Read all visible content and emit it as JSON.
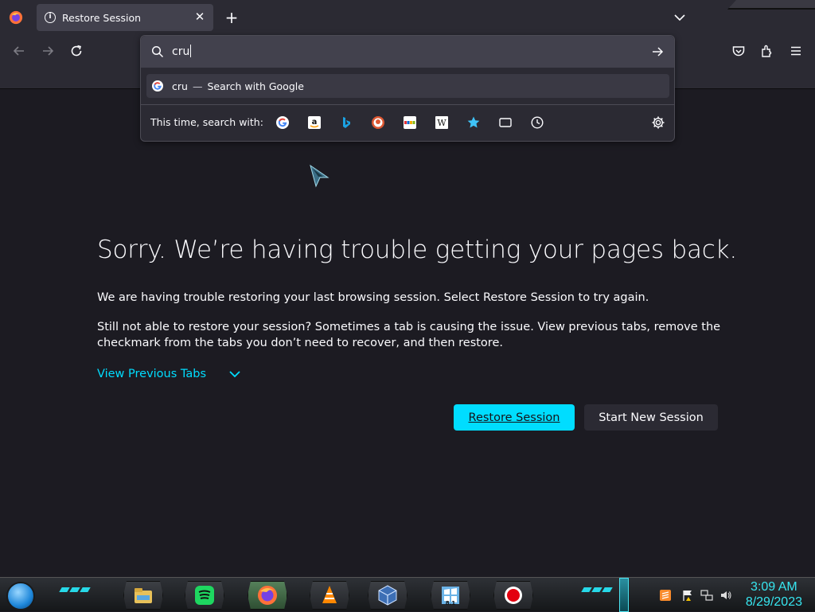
{
  "browser": {
    "tab": {
      "title": "Restore Session"
    },
    "new_tab_symbol": "+",
    "close_symbol": "✕",
    "icons": [
      "firefox-icon",
      "info-icon",
      "close-icon",
      "new-tab-icon",
      "tab-list-chevron-icon",
      "back-icon",
      "forward-icon",
      "reload-icon",
      "pocket-icon",
      "extensions-icon",
      "menu-icon"
    ]
  },
  "urlbar": {
    "typed_text": "cru",
    "suggestion": {
      "query": "cru",
      "separator": "—",
      "action": "Search with Google"
    },
    "one_off_label": "This time, search with:",
    "engines": [
      "google",
      "amazon",
      "bing",
      "duckduckgo",
      "ebay",
      "wikipedia",
      "bookmarks",
      "tabs",
      "history"
    ],
    "settings_icon": "gear-icon"
  },
  "page": {
    "headline": "Sorry. We’re having trouble getting your pages back.",
    "paragraph1": "We are having trouble restoring your last browsing session. Select Restore Session to try again.",
    "paragraph2": "Still not able to restore your session? Sometimes a tab is causing the issue. View previous tabs, remove the checkmark from the tabs you don’t need to recover, and then restore.",
    "view_previous_tabs": "View Previous Tabs",
    "restore_button": "Restore Session",
    "new_session_button": "Start New Session"
  },
  "colors": {
    "accent": "#00ddff",
    "page_bg": "#1c1b22",
    "toolbar_bg": "#2b2a33",
    "urlbar_bg": "#42414d",
    "clock": "#37e6f0"
  },
  "taskbar": {
    "apps": [
      "file-explorer-icon",
      "spotify-icon",
      "firefox-icon",
      "vlc-icon",
      "virtualbox-icon",
      "windows-81-icon",
      "screen-recorder-icon"
    ],
    "windows_badge": "8.1",
    "tray": [
      "sublime-text-icon",
      "action-center-flag-icon",
      "network-icon",
      "volume-icon"
    ],
    "time": "3:09 AM",
    "date": "8/29/2023"
  }
}
